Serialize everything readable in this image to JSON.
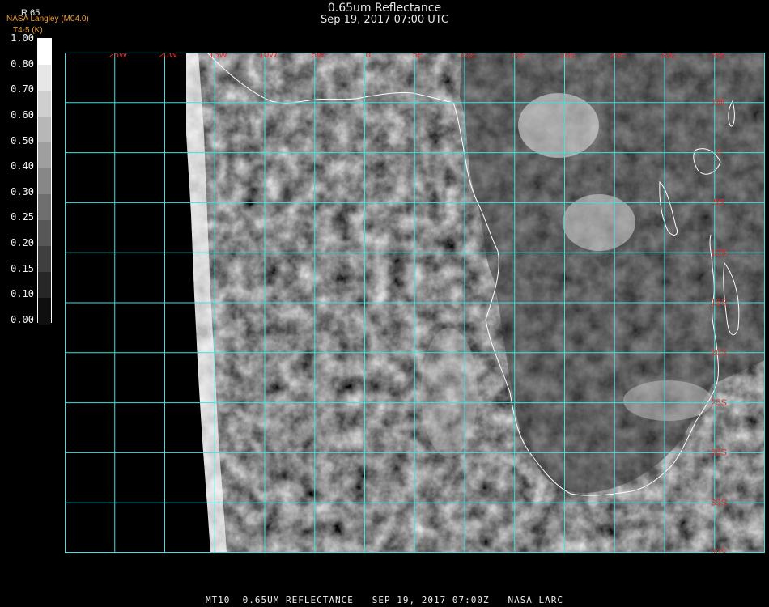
{
  "header": {
    "title": "0.65um Reflectance",
    "subtitle": "Sep 19, 2017 07:00 UTC",
    "credit": "NASA Langley (M04.0)",
    "product": "T4-5 (K)",
    "scale_top": "R 65"
  },
  "colorbar": {
    "labels": [
      "1.00",
      "0.80",
      "0.70",
      "0.60",
      "0.50",
      "0.40",
      "0.30",
      "0.25",
      "0.20",
      "0.15",
      "0.10",
      "0.00"
    ]
  },
  "map": {
    "lon_labels": [
      "25W",
      "20W",
      "15W",
      "10W",
      "5W",
      "0",
      "5E",
      "10E",
      "15E",
      "20E",
      "25E",
      "30E",
      "35E"
    ],
    "lat_labels": [
      "0N",
      "0",
      "5S",
      "10S",
      "15S",
      "20S",
      "25S",
      "30S",
      "35S",
      "40S"
    ],
    "grid_color": "#40e0e0",
    "label_color": "#e03030",
    "coast_color": "#ffffff"
  },
  "footer": {
    "text": "MT10  0.65UM REFLECTANCE   SEP 19, 2017 07:00Z   NASA LARC"
  }
}
